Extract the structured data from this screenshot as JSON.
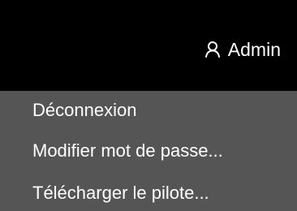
{
  "header": {
    "user": {
      "icon": "user-icon",
      "label": "Admin"
    }
  },
  "menu": {
    "items": [
      {
        "label": "Déconnexion"
      },
      {
        "label": "Modifier mot de passe..."
      },
      {
        "label": "Télécharger le pilote..."
      }
    ]
  },
  "colors": {
    "header_background": "#000000",
    "menu_background": "#555555",
    "text": "#ffffff"
  }
}
